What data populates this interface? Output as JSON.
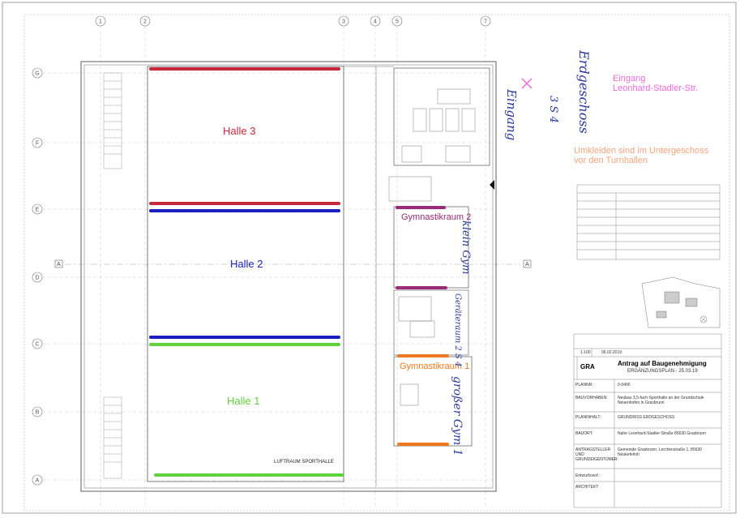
{
  "colors": {
    "halle3": "#c8283c",
    "halle2": "#1a1fc2",
    "halle1": "#5fd23c",
    "gym2": "#9a2a7a",
    "gym1": "#ec7a1e",
    "eingang": "#ec6ad8",
    "umkleiden": "#f5a37a",
    "handwriting": "#2a3aa0"
  },
  "halls": {
    "halle3": "Halle 3",
    "halle2": "Halle 2",
    "halle1": "Halle 1",
    "gym2": "Gymnastikraum 2",
    "gym1": "Gymnastikraum 1"
  },
  "notes": {
    "eingang_line1": "Eingang",
    "eingang_line2": "Leonhard-Stadler-Str.",
    "umkleiden_line1": "Umkleiden sind im Untergeschoss",
    "umkleiden_line2": "vor den Turnhallen"
  },
  "handwriting": {
    "eingang": "Eingang",
    "sym": "3 S 4",
    "erdgeschoss": "Erdgeschoss",
    "klein_gym": "klein Gym",
    "geraete": "Geräteraum 2 S 4",
    "gross_gym": "großer Gym 1"
  },
  "plan": {
    "luftraum": "LUFTRAUM SPORTHALLE",
    "column_labels": [
      "1",
      "2",
      "3",
      "4",
      "5",
      "7"
    ],
    "row_labels": [
      "G",
      "F",
      "E",
      "D",
      "C",
      "B",
      "A"
    ],
    "section_mark": "A"
  },
  "title_block": {
    "code": "GRA",
    "heading": "Antrag auf Baugenehmigung",
    "subheading": "ERGÄNZUNGSPLAN - 25.03.19",
    "scale": "1:100",
    "date": "06.02.2019",
    "plan_nr_label": "PLANNR:",
    "plan_nr": "0-0400",
    "bauvorhaben_label": "BAUVORHABEN:",
    "bauvorhaben": "Neubau 3,5-fach-Sporthalle an der Grundschule Neuenhofen in Grasbrunn",
    "planinhalt_label": "PLANINHALT:",
    "planinhalt": "GRUNDRISS ERDGESCHOSS",
    "bauort_label": "BAUORT:",
    "bauort": "Nahe Leonhard-Stadler-Straße 85630 Grasbrunn",
    "antragsteller_label": "ANTRAGSTELLER UND GRUNDEIGENTÜMER:",
    "antragsteller": "Gemeinde Grasbrunn, Lerchenstraße 1, 85630 Neukeferloh",
    "entwurf_label": "Entwurfsverf.:",
    "architekt_label": "ARCHITEKT:"
  }
}
